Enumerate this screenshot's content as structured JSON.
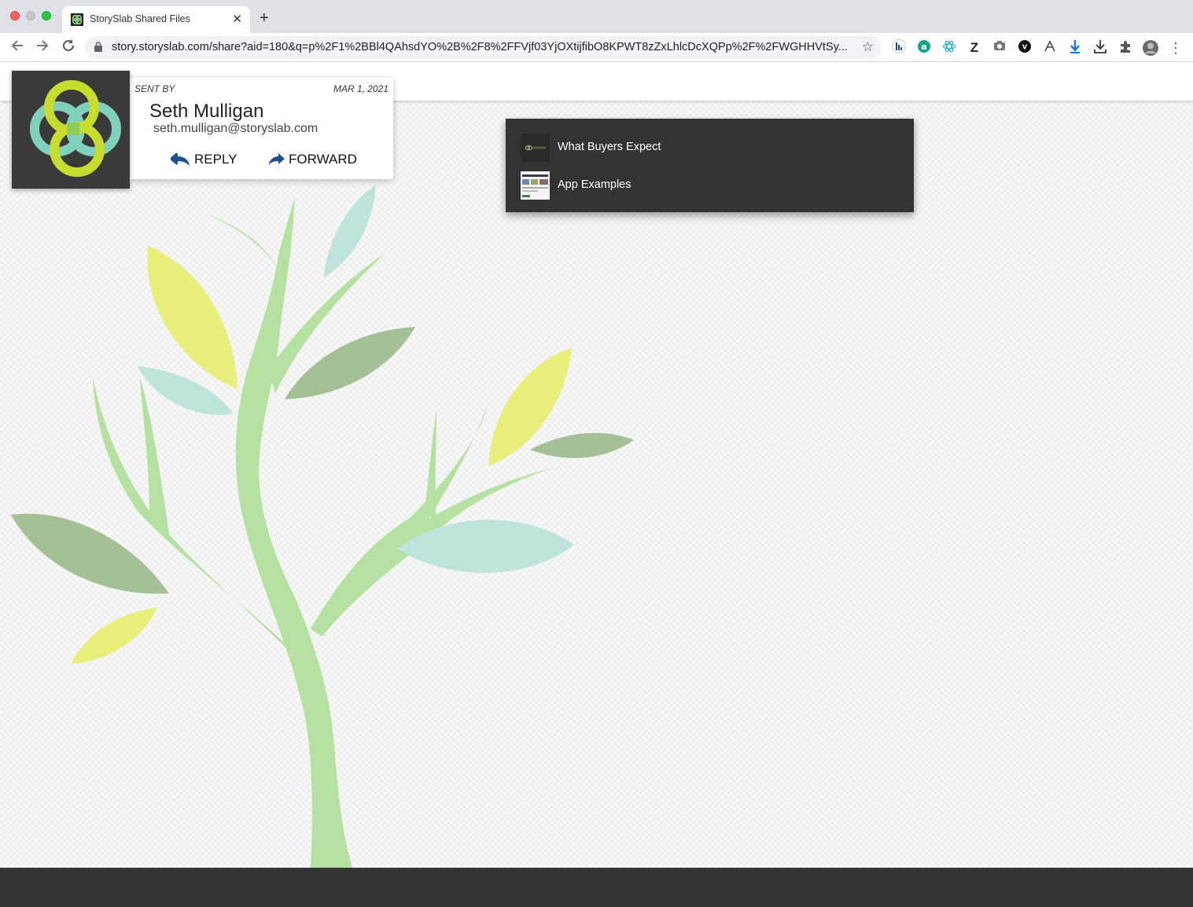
{
  "browser": {
    "tab_title": "StorySlab Shared Files",
    "new_tab_symbol": "+",
    "close_symbol": "✕",
    "url": "story.storyslab.com/share?aid=180&q=p%2F1%2BBl4QAhsdYO%2B%2F8%2FFVjf03YjOXtijfibO8KPWT8zZxLhlcDcXQPp%2F%2FWGHHVtSy..."
  },
  "sender": {
    "sent_by_label": "SENT BY",
    "date": "MAR 1, 2021",
    "name": "Seth Mulligan",
    "email": "seth.mulligan@storyslab.com",
    "reply_label": "REPLY",
    "forward_label": "FORWARD"
  },
  "files": [
    {
      "title": "What Buyers Expect",
      "thumb_icon": "storyslab-thumbnail"
    },
    {
      "title": "App Examples",
      "thumb_icon": "screenshot-thumbnail"
    }
  ],
  "colors": {
    "accent_blue": "#1d4f91",
    "panel_dark": "#333333",
    "logo_green": "#c8dc2e",
    "logo_teal": "#7fd0bd"
  }
}
